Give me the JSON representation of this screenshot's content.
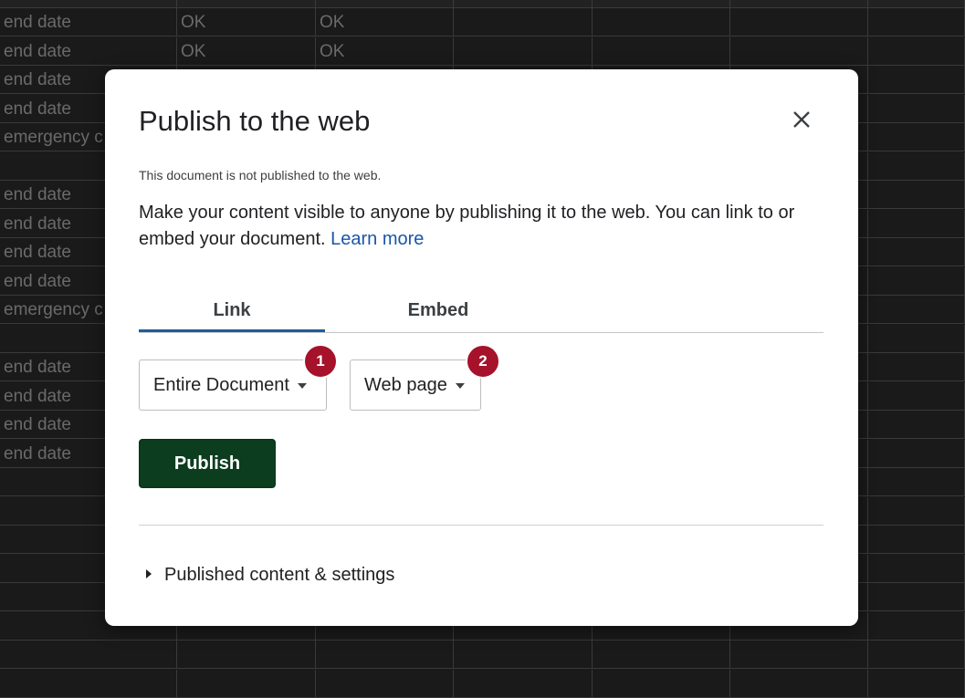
{
  "background_sheet": {
    "rows": [
      [
        "end date",
        "OK",
        "OK"
      ],
      [
        "end date",
        "OK",
        "OK"
      ],
      [
        "end date",
        "",
        ""
      ],
      [
        "end date",
        "",
        ""
      ],
      [
        "emergency c",
        "",
        ""
      ],
      [
        "",
        "",
        ""
      ],
      [
        "end date",
        "",
        ""
      ],
      [
        "end date",
        "",
        ""
      ],
      [
        "end date",
        "",
        ""
      ],
      [
        "end date",
        "",
        ""
      ],
      [
        "emergency c",
        "",
        ""
      ],
      [
        "",
        "",
        ""
      ],
      [
        "end date",
        "",
        ""
      ],
      [
        "end date",
        "",
        ""
      ],
      [
        "end date",
        "",
        ""
      ],
      [
        "end date",
        "",
        ""
      ],
      [
        "",
        "",
        ""
      ],
      [
        "",
        "",
        ""
      ],
      [
        "",
        "",
        ""
      ],
      [
        "",
        "",
        ""
      ],
      [
        "",
        "",
        ""
      ],
      [
        "",
        "",
        ""
      ],
      [
        "",
        "",
        ""
      ],
      [
        "",
        "",
        ""
      ]
    ]
  },
  "dialog": {
    "title": "Publish to the web",
    "close_icon": "close-icon",
    "status": "This document is not published to the web.",
    "description": "Make your content visible to anyone by publishing it to the web. You can link to or embed your document.",
    "learn_more": "Learn more",
    "tabs": [
      {
        "label": "Link",
        "active": true
      },
      {
        "label": "Embed",
        "active": false
      }
    ],
    "scope_select": {
      "value": "Entire Document"
    },
    "format_select": {
      "value": "Web page"
    },
    "badges": [
      "1",
      "2"
    ],
    "publish_label": "Publish",
    "published_settings_label": "Published content & settings"
  },
  "colors": {
    "publish_button": "#0b3d1e",
    "tab_indicator": "#1b5e9e",
    "badge": "#a5122a",
    "link": "#1a56a8"
  }
}
